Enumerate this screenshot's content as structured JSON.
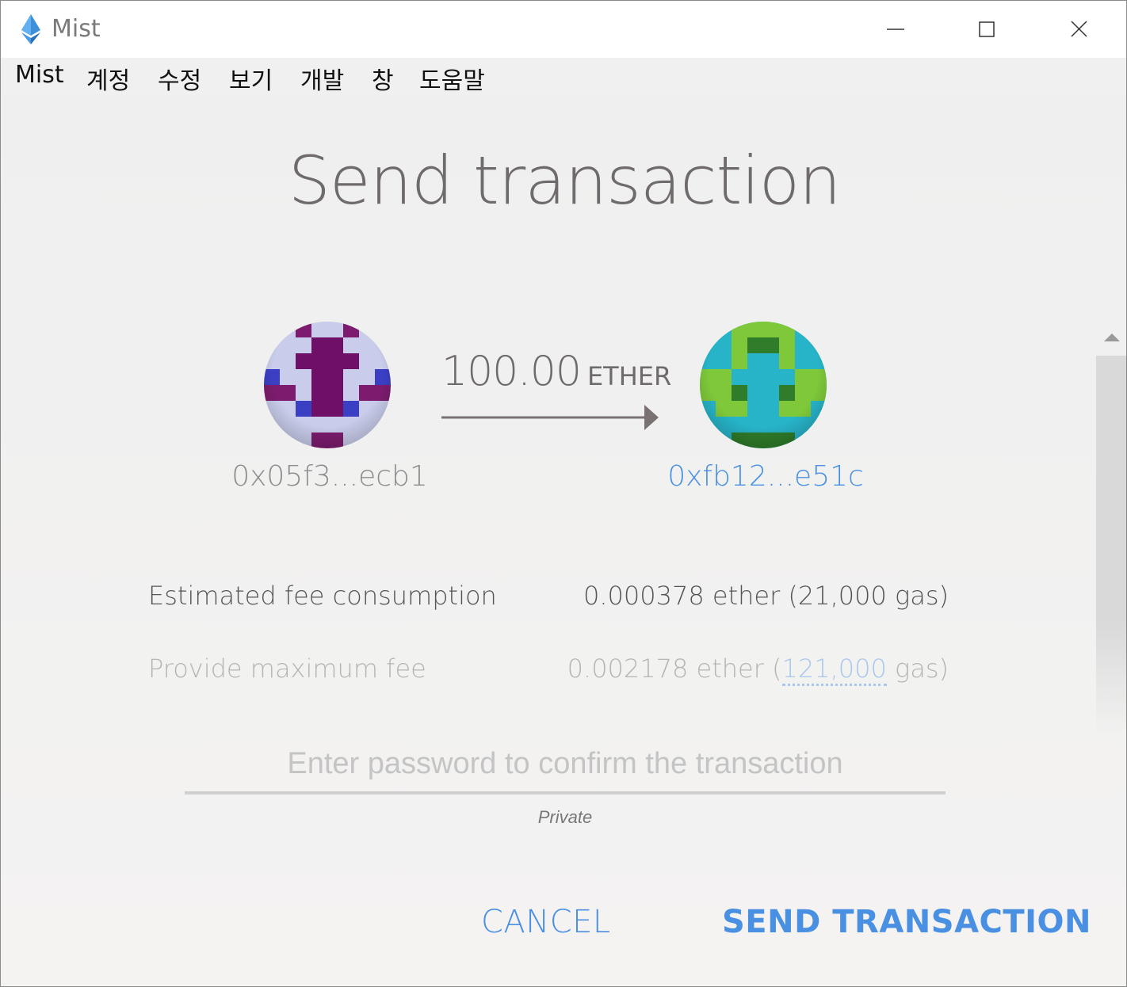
{
  "window": {
    "title": "Mist"
  },
  "menu": {
    "items": [
      {
        "label": "Mist"
      },
      {
        "label": "계정"
      },
      {
        "label": "수정"
      },
      {
        "label": "보기"
      },
      {
        "label": "개발"
      },
      {
        "label": "창"
      },
      {
        "label": "도움말"
      }
    ]
  },
  "page": {
    "title": "Send transaction"
  },
  "transaction": {
    "from_address": "0x05f3...ecb1",
    "to_address": "0xfb12...e51c",
    "amount": "100.00",
    "unit": "ETHER"
  },
  "fees": {
    "estimated_label": "Estimated fee consumption",
    "estimated_value": "0.000378 ether (21,000 gas)",
    "max_label": "Provide maximum fee",
    "max_prefix": "0.002178 ether (",
    "max_gas": "121,000",
    "max_suffix": " gas)"
  },
  "password": {
    "placeholder": "Enter password to confirm the transaction",
    "note": "Private"
  },
  "buttons": {
    "cancel": "CANCEL",
    "send": "SEND TRANSACTION"
  },
  "colors": {
    "accent": "#4a90e2",
    "title_text": "#6f6a6b",
    "background": "#f2f2f2"
  },
  "icons": {
    "app": "ethereum-logo-icon",
    "minimize": "minimize-icon",
    "maximize": "maximize-icon",
    "close": "close-icon",
    "from_identicon": "identicon-purple",
    "to_identicon": "identicon-green-blue",
    "arrow": "arrow-right-icon",
    "scroll_up": "scroll-up-icon"
  }
}
